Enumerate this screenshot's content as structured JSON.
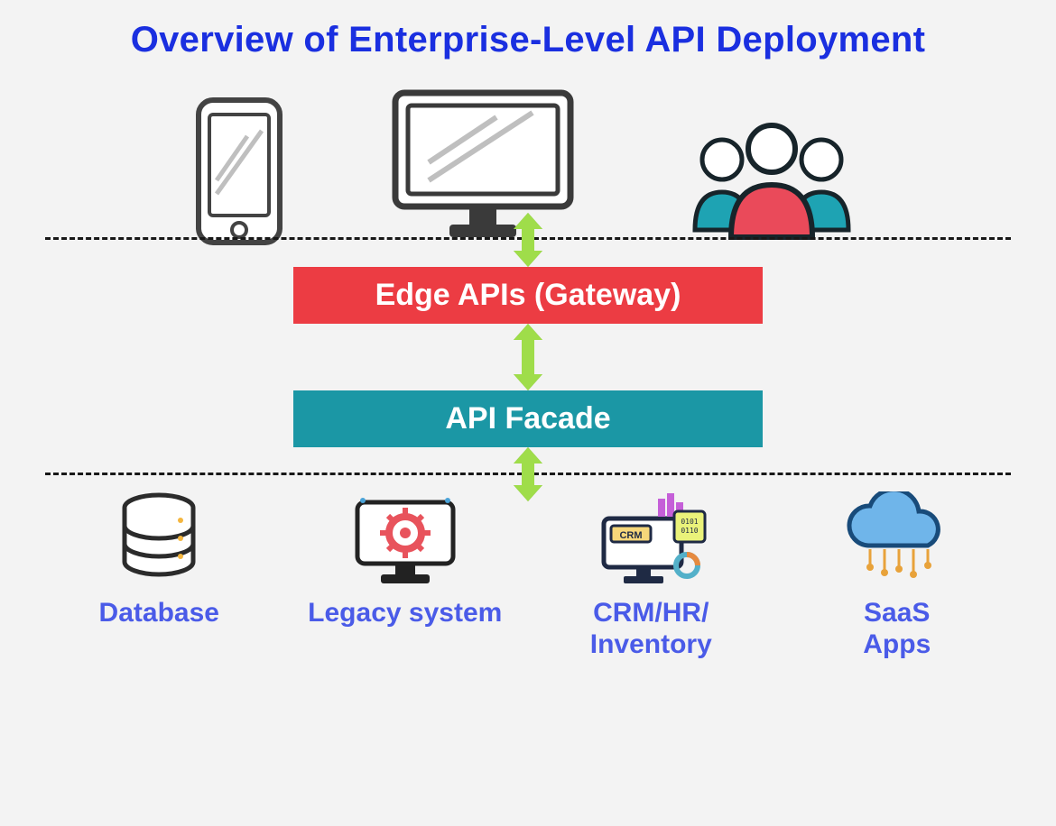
{
  "title": "Overview of Enterprise-Level API Deployment",
  "layers": {
    "edge_label": "Edge APIs (Gateway)",
    "facade_label": "API Facade"
  },
  "clients": [
    {
      "icon": "mobile-icon"
    },
    {
      "icon": "desktop-icon"
    },
    {
      "icon": "users-icon"
    }
  ],
  "backends": [
    {
      "icon": "database-icon",
      "label": "Database"
    },
    {
      "icon": "legacy-icon",
      "label": "Legacy system"
    },
    {
      "icon": "crm-icon",
      "label": "CRM/HR/\nInventory"
    },
    {
      "icon": "cloud-icon",
      "label": "SaaS\nApps"
    }
  ],
  "colors": {
    "title": "#1a2fe0",
    "edge_box": "#ec3c43",
    "facade_box": "#1b97a5",
    "arrow": "#9fdd4a",
    "backend_label": "#4a5be8"
  }
}
